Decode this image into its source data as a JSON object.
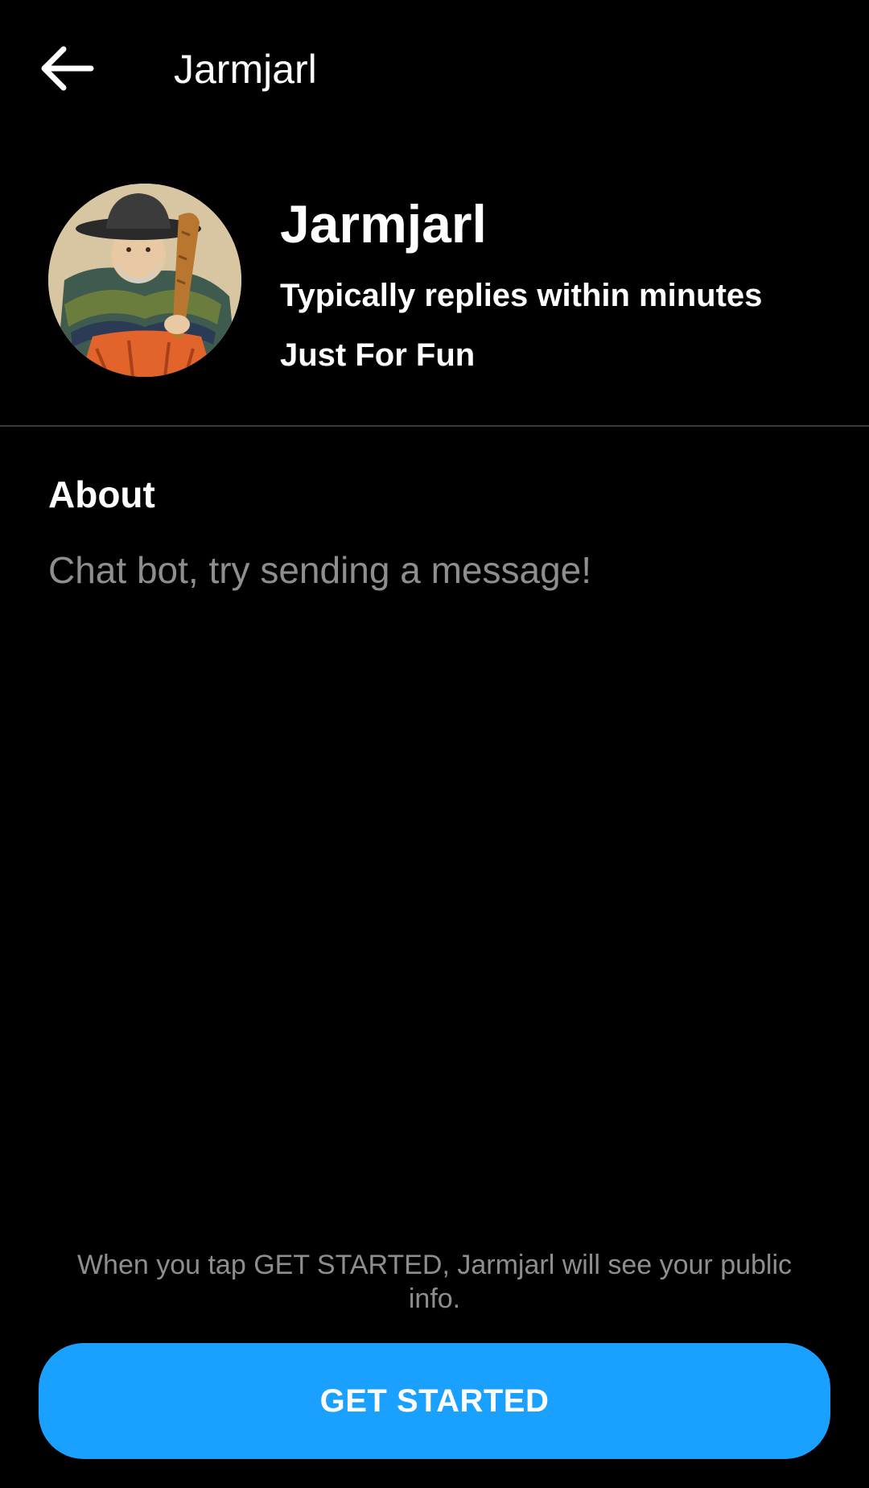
{
  "app_bar": {
    "back_icon": "arrow-left-icon",
    "title": "Jarmjarl"
  },
  "profile": {
    "avatar_icon": "bot-avatar",
    "name": "Jarmjarl",
    "response_time": "Typically replies within minutes",
    "category": "Just For Fun"
  },
  "about": {
    "heading": "About",
    "text": "Chat bot, try sending a message!"
  },
  "footer": {
    "disclaimer": "When you tap GET STARTED, Jarmjarl will see your public info.",
    "button_label": "GET STARTED"
  },
  "colors": {
    "background": "#000000",
    "primary_text": "#ffffff",
    "secondary_text": "#8e8e8e",
    "accent": "#1aa1ff",
    "divider": "#3a3a3a"
  }
}
